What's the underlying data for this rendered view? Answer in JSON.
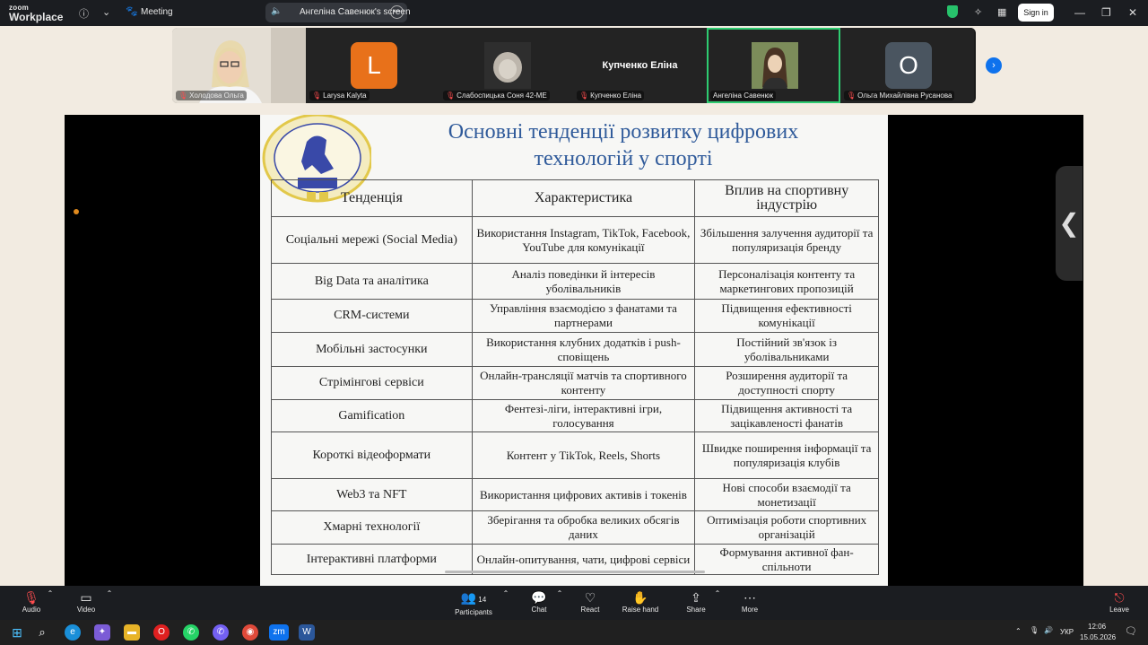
{
  "app": {
    "brand_top": "zoom",
    "brand_bottom": "Workplace",
    "meeting_label": "Meeting"
  },
  "screen_chip": {
    "label": "Ангеліна Савенюк's screen"
  },
  "signin": "Sign in",
  "participants": [
    {
      "name": "Холодова Ольга",
      "type": "video"
    },
    {
      "name": "Larysa Kalyta",
      "type": "avatar",
      "letter": "L",
      "color": "#e8711a"
    },
    {
      "name": "Слабоспицька Соня 42-МЕ",
      "type": "photo"
    },
    {
      "name": "Купченко Еліна",
      "type": "text",
      "big": "Купченко Еліна"
    },
    {
      "name": "Ангеліна Савенюк",
      "type": "photo",
      "active": true
    },
    {
      "name": "Ольга Михайлівна Русанова",
      "type": "avatar",
      "letter": "О",
      "color": "#4a5560"
    }
  ],
  "slide": {
    "title_line1": "Основні тенденції розвитку цифрових",
    "title_line2": "технологій у спорті",
    "headers": [
      "Тенденція",
      "Характеристика",
      "Вплив на спортивну індустрію"
    ],
    "rows": [
      [
        "Соціальні мережі (Social Media)",
        "Використання Instagram, TikTok, Facebook, YouTube для комунікації",
        "Збільшення залучення аудиторії та популяризація бренду"
      ],
      [
        "Big Data та аналітика",
        "Аналіз поведінки й інтересів уболівальників",
        "Персоналізація контенту та маркетингових пропозицій"
      ],
      [
        "CRM-системи",
        "Управління взаємодією з фанатами та партнерами",
        "Підвищення ефективності комунікації"
      ],
      [
        "Мобільні застосунки",
        "Використання клубних додатків і push-сповіщень",
        "Постійний зв'язок із уболівальниками"
      ],
      [
        "Стрімінгові сервіси",
        "Онлайн-трансляції матчів та спортивного контенту",
        "Розширення аудиторії та доступності спорту"
      ],
      [
        "Gamification",
        "Фентезі-ліги, інтерактивні ігри, голосування",
        "Підвищення активності та зацікавленості фанатів"
      ],
      [
        "Короткі відеоформати",
        "Контент у TikTok, Reels, Shorts",
        "Швидке поширення інформації та популяризація клубів"
      ],
      [
        "Web3 та NFT",
        "Використання цифрових активів і токенів",
        "Нові способи взаємодії та монетизації"
      ],
      [
        "Хмарні технології",
        "Зберігання та обробка великих обсягів даних",
        "Оптимізація роботи спортивних організацій"
      ],
      [
        "Інтерактивні платформи",
        "Онлайн-опитування, чати, цифрові сервіси",
        "Формування активної фан-спільноти"
      ]
    ]
  },
  "toolbar": {
    "audio": "Audio",
    "video": "Video",
    "participants": "Participants",
    "participants_count": "14",
    "chat": "Chat",
    "react": "React",
    "raise_hand": "Raise hand",
    "share": "Share",
    "more": "More",
    "leave": "Leave"
  },
  "taskbar": {
    "lang": "УКР",
    "time": "12:06",
    "date": "15.05.2026"
  },
  "colors": {
    "accent": "#0e72ed",
    "active_border": "#2ecc71",
    "slide_title": "#2f5a9a"
  }
}
